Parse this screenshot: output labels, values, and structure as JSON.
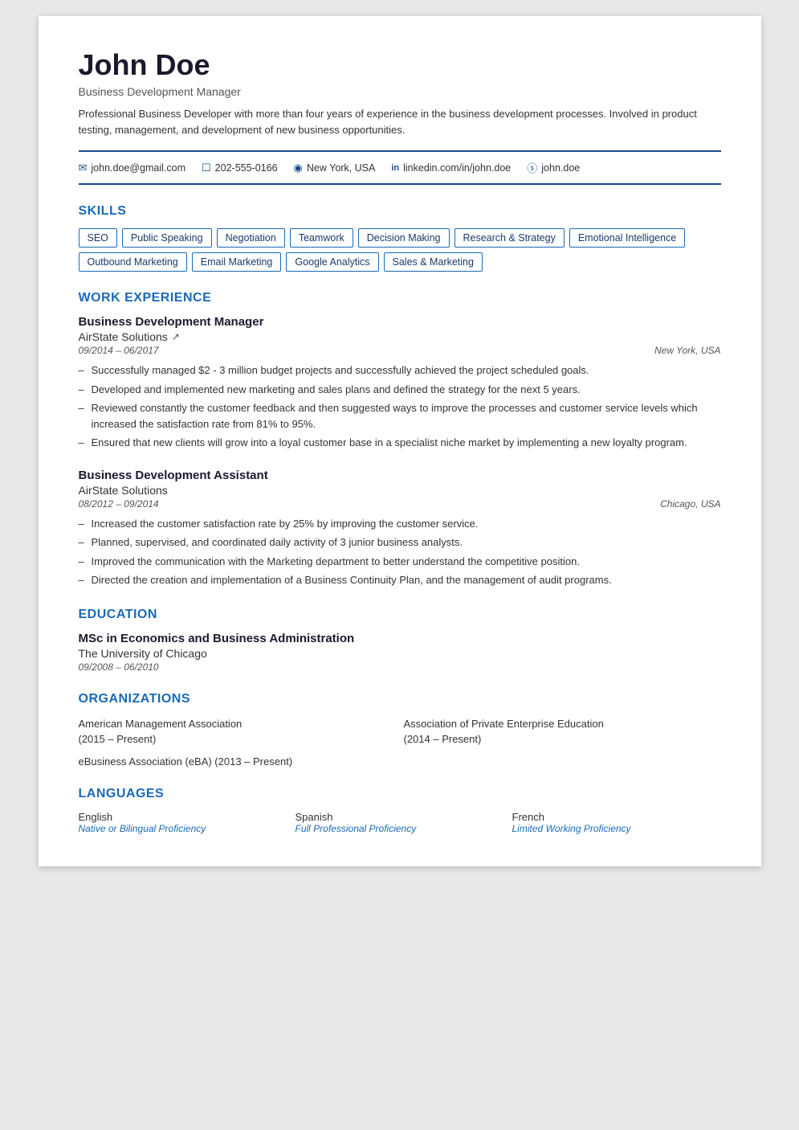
{
  "header": {
    "name": "John Doe",
    "title": "Business Development Manager",
    "summary": "Professional Business Developer with more than four years of experience in the business development processes. Involved in product testing, management, and development of new business opportunities."
  },
  "contact": {
    "email": "john.doe@gmail.com",
    "phone": "202-555-0166",
    "location": "New York, USA",
    "linkedin": "linkedin.com/in/john.doe",
    "skype": "john.doe"
  },
  "skills": {
    "section_title": "SKILLS",
    "tags": [
      "SEO",
      "Public Speaking",
      "Negotiation",
      "Teamwork",
      "Decision Making",
      "Research & Strategy",
      "Emotional Intelligence",
      "Outbound Marketing",
      "Email Marketing",
      "Google Analytics",
      "Sales & Marketing"
    ]
  },
  "work_experience": {
    "section_title": "WORK EXPERIENCE",
    "jobs": [
      {
        "title": "Business Development Manager",
        "company": "AirState Solutions",
        "has_link": true,
        "dates": "09/2014 – 06/2017",
        "location": "New York, USA",
        "bullets": [
          "Successfully managed $2 - 3 million budget projects and successfully achieved the project scheduled goals.",
          "Developed and implemented new marketing and sales plans and defined the strategy for the next 5 years.",
          "Reviewed constantly the customer feedback and then suggested ways to improve the processes and customer service levels which increased the satisfaction rate from 81% to 95%.",
          "Ensured that new clients will grow into a loyal customer base in a specialist niche market by implementing a new loyalty program."
        ]
      },
      {
        "title": "Business Development Assistant",
        "company": "AirState Solutions",
        "has_link": false,
        "dates": "08/2012 – 09/2014",
        "location": "Chicago, USA",
        "bullets": [
          "Increased the customer satisfaction rate by 25% by improving the customer service.",
          "Planned, supervised, and coordinated daily activity of 3 junior business analysts.",
          "Improved the communication with the Marketing department to better understand the competitive position.",
          "Directed the creation and implementation of a Business Continuity Plan, and the management of audit programs."
        ]
      }
    ]
  },
  "education": {
    "section_title": "EDUCATION",
    "entries": [
      {
        "degree": "MSc in Economics and Business Administration",
        "school": "The University of Chicago",
        "dates": "09/2008 – 06/2010"
      }
    ]
  },
  "organizations": {
    "section_title": "ORGANIZATIONS",
    "items": [
      {
        "name": "American Management Association",
        "years": "(2015 – Present)"
      },
      {
        "name": "Association of Private Enterprise Education",
        "years": "(2014 – Present)"
      },
      {
        "name": "eBusiness Association (eBA) (2013 – Present)",
        "years": ""
      }
    ]
  },
  "languages": {
    "section_title": "LANGUAGES",
    "items": [
      {
        "name": "English",
        "level": "Native or Bilingual Proficiency"
      },
      {
        "name": "Spanish",
        "level": "Full Professional Proficiency"
      },
      {
        "name": "French",
        "level": "Limited Working Proficiency"
      }
    ]
  }
}
